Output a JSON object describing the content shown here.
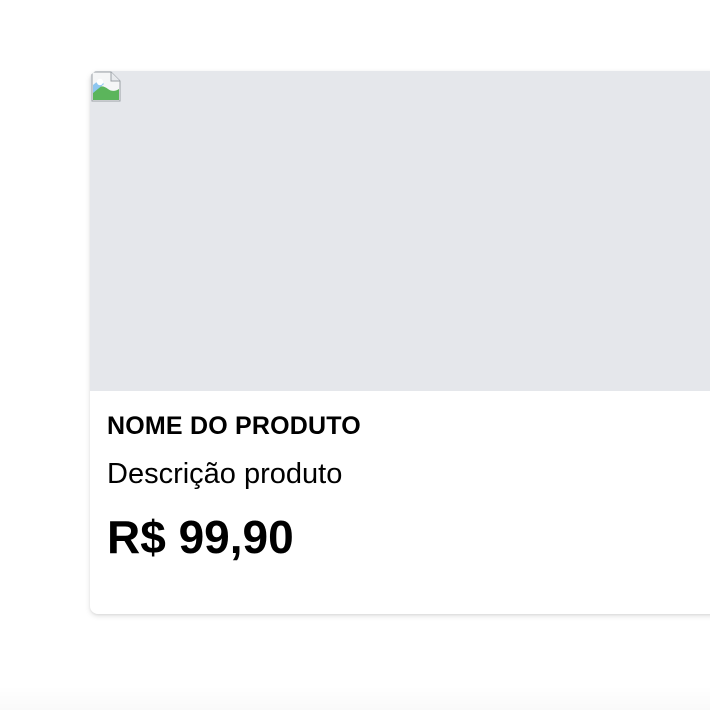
{
  "product_card": {
    "image_icon": "broken-image-icon",
    "name": "NOME DO PRODUTO",
    "description": "Descrição produto",
    "price": "R$ 99,90"
  },
  "colors": {
    "image_placeholder_bg": "#e5e7eb",
    "card_bg": "#ffffff",
    "text": "#000000"
  }
}
